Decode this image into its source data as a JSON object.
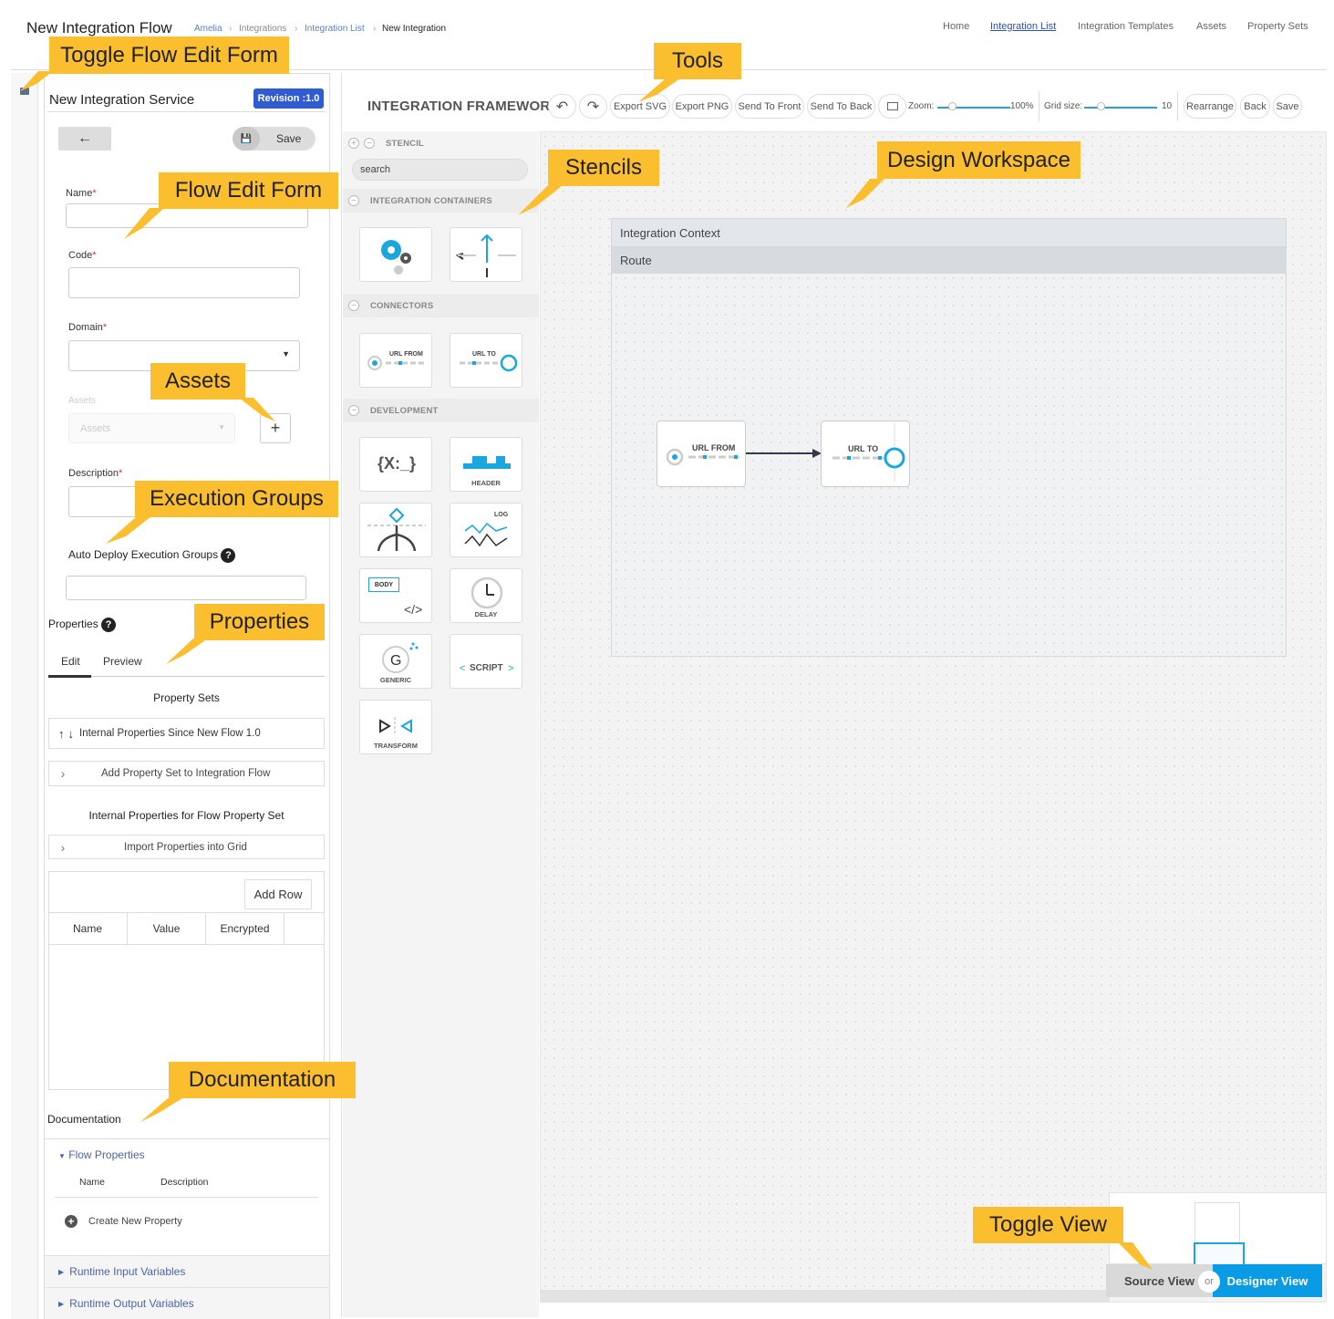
{
  "header": {
    "title": "New Integration Flow",
    "breadcrumbs": [
      "Amelia",
      "Integrations",
      "Integration List",
      "New Integration"
    ],
    "nav": [
      "Home",
      "Integration List",
      "Integration Templates",
      "Assets",
      "Property Sets"
    ],
    "active_nav": "Integration List"
  },
  "service": {
    "title": "New Integration Service",
    "revision": "Revision :1.0",
    "back_icon": "arrow-left-icon",
    "save_label": "Save"
  },
  "form": {
    "name_label": "Name",
    "code_label": "Code",
    "domain_label": "Domain",
    "assets_label": "Assets",
    "assets_placeholder": "Assets",
    "description_label": "Description",
    "auto_deploy_label": "Auto Deploy Execution Groups",
    "required_mark": "*"
  },
  "properties": {
    "title": "Properties",
    "tabs": [
      "Edit",
      "Preview"
    ],
    "property_sets_heading": "Property Sets",
    "internal_since": "Internal Properties Since New Flow 1.0",
    "add_property_set": "Add Property Set to Integration Flow",
    "internal_for_set": "Internal Properties for Flow Property Set",
    "import_properties": "Import Properties into Grid",
    "add_row": "Add Row",
    "columns": [
      "Name",
      "Value",
      "Encrypted"
    ]
  },
  "documentation": {
    "title": "Documentation",
    "flow_properties": "Flow Properties",
    "columns": [
      "Name",
      "Description"
    ],
    "create_new": "Create New Property",
    "runtime_input": "Runtime Input Variables",
    "runtime_output": "Runtime Output Variables"
  },
  "framework": {
    "title": "INTEGRATION FRAMEWORK",
    "tools": {
      "undo_icon": "undo-icon",
      "redo_icon": "redo-icon",
      "export_svg": "Export SVG",
      "export_png": "Export PNG",
      "send_front": "Send To Front",
      "send_back": "Send To Back",
      "fit_icon": "fit-to-screen-icon",
      "zoom_label": "Zoom:",
      "zoom_value": "100%",
      "grid_label": "Grid size:",
      "grid_value": "10",
      "rearrange": "Rearrange",
      "back": "Back",
      "save": "Save"
    }
  },
  "stencil": {
    "header": "STENCIL",
    "search": "search",
    "sections": [
      "INTEGRATION CONTAINERS",
      "CONNECTORS",
      "DEVELOPMENT"
    ],
    "tiles": {
      "url_from": "URL FROM",
      "url_to": "URL TO",
      "header": "HEADER",
      "log": "LOG",
      "body": "BODY",
      "delay": "DELAY",
      "generic": "GENERIC",
      "script": "SCRIPT",
      "transform": "TRANSFORM",
      "var_text": "{X:_}",
      "generic_letter": "G",
      "code_text": "</>"
    }
  },
  "workspace": {
    "context": "Integration Context",
    "route": "Route",
    "node_from": "URL FROM",
    "node_to": "URL TO"
  },
  "view_toggle": {
    "source": "Source View",
    "or": "or",
    "designer": "Designer View"
  },
  "callouts": {
    "toggle_form": "Toggle Flow Edit Form",
    "tools": "Tools",
    "flow_form": "Flow Edit Form",
    "stencils": "Stencils",
    "design_workspace": "Design Workspace",
    "assets": "Assets",
    "execution_groups": "Execution Groups",
    "properties": "Properties",
    "documentation": "Documentation",
    "toggle_view": "Toggle View"
  },
  "colors": {
    "accent_blue": "#0a9be5",
    "revision_blue": "#2f5bd3",
    "callout_yellow": "#fbbe2e",
    "node_cyan": "#1aa7e0"
  }
}
